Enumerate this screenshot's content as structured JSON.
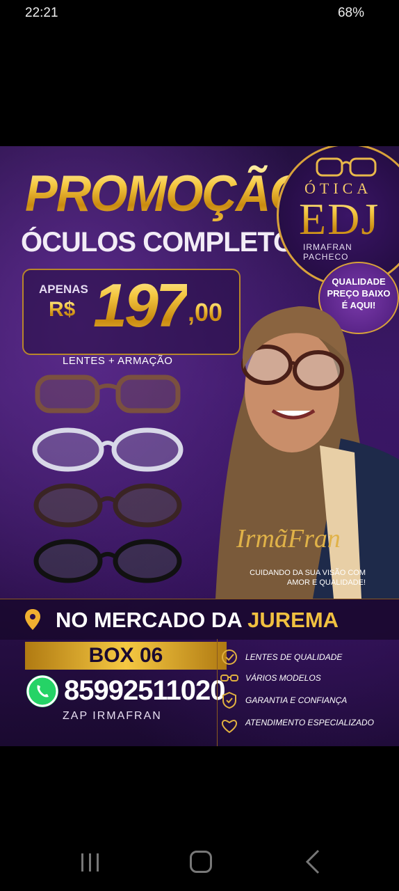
{
  "status_bar": {
    "time": "22:21",
    "battery": "68%"
  },
  "poster": {
    "title": "PROMOÇÃO",
    "subtitle": "ÓCULOS COMPLETO",
    "price": {
      "prefix": "APENAS",
      "currency": "R$",
      "integer": "197",
      "cents": ",00"
    },
    "price_note": "LENTES + ARMAÇÃO",
    "logo": {
      "line1": "ÓTICA",
      "brand": "EDJ",
      "owner": "IRMAFRAN PACHECO"
    },
    "quality_badge": {
      "line1": "QUALIDADE",
      "line2": "PREÇO BAIXO",
      "line3": "É AQUI!"
    },
    "signature": "IrmãFran",
    "care_text": "CUIDANDO DA SUA VISÃO COM AMOR E QUALIDADE!",
    "location": {
      "prefix": "NO MERCADO DA ",
      "highlight": "JUREMA"
    },
    "box": "BOX 06",
    "phone": "85992511020",
    "zap_label": "ZAP IRMAFRAN",
    "features": [
      {
        "icon": "check-circle-icon",
        "label": "LENTES DE QUALIDADE"
      },
      {
        "icon": "glasses-icon",
        "label": "VÁRIOS MODELOS"
      },
      {
        "icon": "shield-check-icon",
        "label": "GARANTIA E CONFIANÇA"
      },
      {
        "icon": "heart-icon",
        "label": "ATENDIMENTO ESPECIALIZADO"
      }
    ],
    "colors": {
      "gold": "#f0c040",
      "purple": "#3b1a66",
      "whatsapp": "#25d366"
    }
  }
}
